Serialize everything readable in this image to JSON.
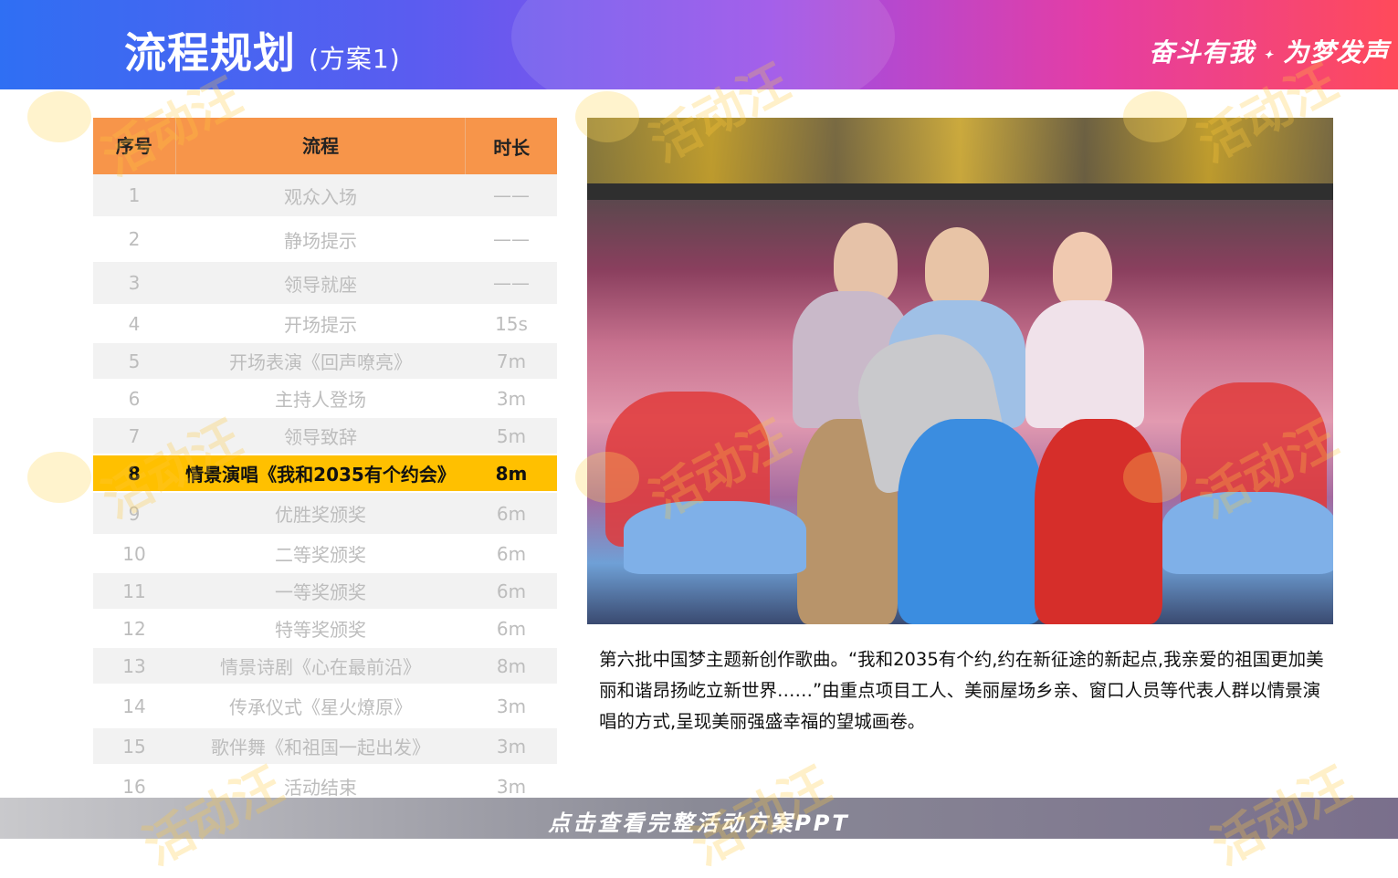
{
  "header": {
    "title": "流程规划",
    "subtitle": "(方案1)",
    "brand_left": "奋斗有我",
    "brand_right": "为梦发声"
  },
  "table": {
    "headers": [
      "序号",
      "流程",
      "时长"
    ],
    "rows": [
      {
        "no": "1",
        "item": "观众入场",
        "duration": "——"
      },
      {
        "no": "2",
        "item": "静场提示",
        "duration": "——"
      },
      {
        "no": "3",
        "item": "领导就座",
        "duration": "——"
      },
      {
        "no": "4",
        "item": "开场提示",
        "duration": "15s"
      },
      {
        "no": "5",
        "item": "开场表演《回声嘹亮》",
        "duration": "7m"
      },
      {
        "no": "6",
        "item": "主持人登场",
        "duration": "3m"
      },
      {
        "no": "7",
        "item": "领导致辞",
        "duration": "5m"
      },
      {
        "no": "8",
        "item": "情景演唱《我和2035有个约会》",
        "duration": "8m"
      },
      {
        "no": "9",
        "item": "优胜奖颁奖",
        "duration": "6m"
      },
      {
        "no": "10",
        "item": "二等奖颁奖",
        "duration": "6m"
      },
      {
        "no": "11",
        "item": "一等奖颁奖",
        "duration": "6m"
      },
      {
        "no": "12",
        "item": "特等奖颁奖",
        "duration": "6m"
      },
      {
        "no": "13",
        "item": "情景诗剧《心在最前沿》",
        "duration": "8m"
      },
      {
        "no": "14",
        "item": "传承仪式《星火燎原》",
        "duration": "3m"
      },
      {
        "no": "15",
        "item": "歌伴舞《和祖国一起出发》",
        "duration": "3m"
      },
      {
        "no": "16",
        "item": "活动结束",
        "duration": "3m"
      }
    ]
  },
  "caption": "第六批中国梦主题新创作歌曲。“我和2035有个约,约在新征途的新起点,我亲爱的祖国更加美丽和谐昂扬屹立新世界……”由重点项目工人、美丽屋场乡亲、窗口人员等代表人群以情景演唱的方式,呈现美丽强盛幸福的望城画卷。",
  "footer": {
    "cta": "点击查看完整活动方案PPT"
  },
  "watermark": "活动汪",
  "colors": {
    "header_orange": "#f7954a",
    "highlight": "#ffc000",
    "alt_row": "#f2f2f2"
  }
}
